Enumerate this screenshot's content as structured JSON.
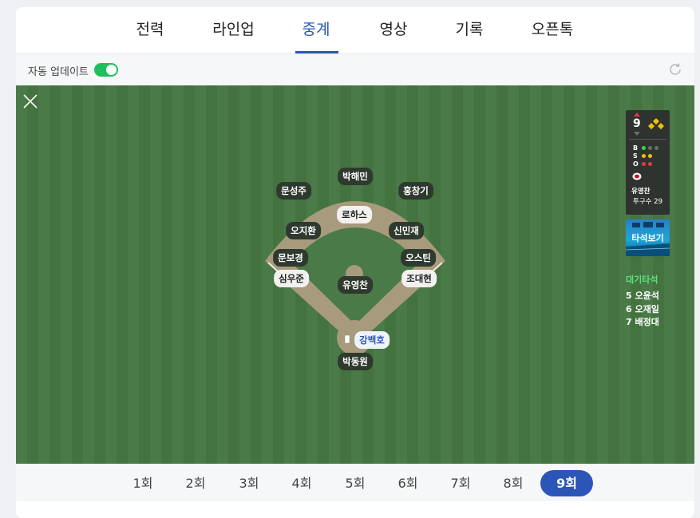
{
  "tabs": [
    {
      "label": "전력"
    },
    {
      "label": "라인업"
    },
    {
      "label": "중계",
      "active": true
    },
    {
      "label": "영상"
    },
    {
      "label": "기록"
    },
    {
      "label": "오픈톡"
    }
  ],
  "auto_update": {
    "label": "자동 업데이트",
    "on": true
  },
  "field": {
    "fielders": {
      "center_field": "박해민",
      "left_field": "문성주",
      "right_field": "홍창기",
      "second_base": "로하스",
      "shortstop": "오지환",
      "first_base": "신민재",
      "third_base": "문보경",
      "right_side_runner_label": "오스틴",
      "left_coach": "심우준",
      "right_coach": "조대현",
      "pitcher": "유영찬",
      "batter": "강백호",
      "catcher": "박동원"
    }
  },
  "scoreboard": {
    "inning": "9",
    "half": "top",
    "balls_label": "B",
    "strikes_label": "S",
    "outs_label": "O",
    "balls": 1,
    "strikes": 2,
    "outs": 2,
    "pitcher_name": "유영찬",
    "pitch_count": "투구수 29",
    "colors": {
      "ball": "#3fd14a",
      "strike": "#f2c200",
      "out": "#e23b3b",
      "empty": "#6b6f6c"
    }
  },
  "replay_button": {
    "label": "타석보기"
  },
  "waiting": {
    "title": "대기타석",
    "batters": [
      "5 오윤석",
      "6 오재일",
      "7 배정대"
    ]
  },
  "innings": {
    "items": [
      "1회",
      "2회",
      "3회",
      "4회",
      "5회",
      "6회",
      "7회",
      "8회",
      "9회"
    ],
    "active": "9회"
  },
  "colors": {
    "accent": "#2c55b8",
    "field": "#4a7a48",
    "toggle_on": "#1fbf5c"
  }
}
